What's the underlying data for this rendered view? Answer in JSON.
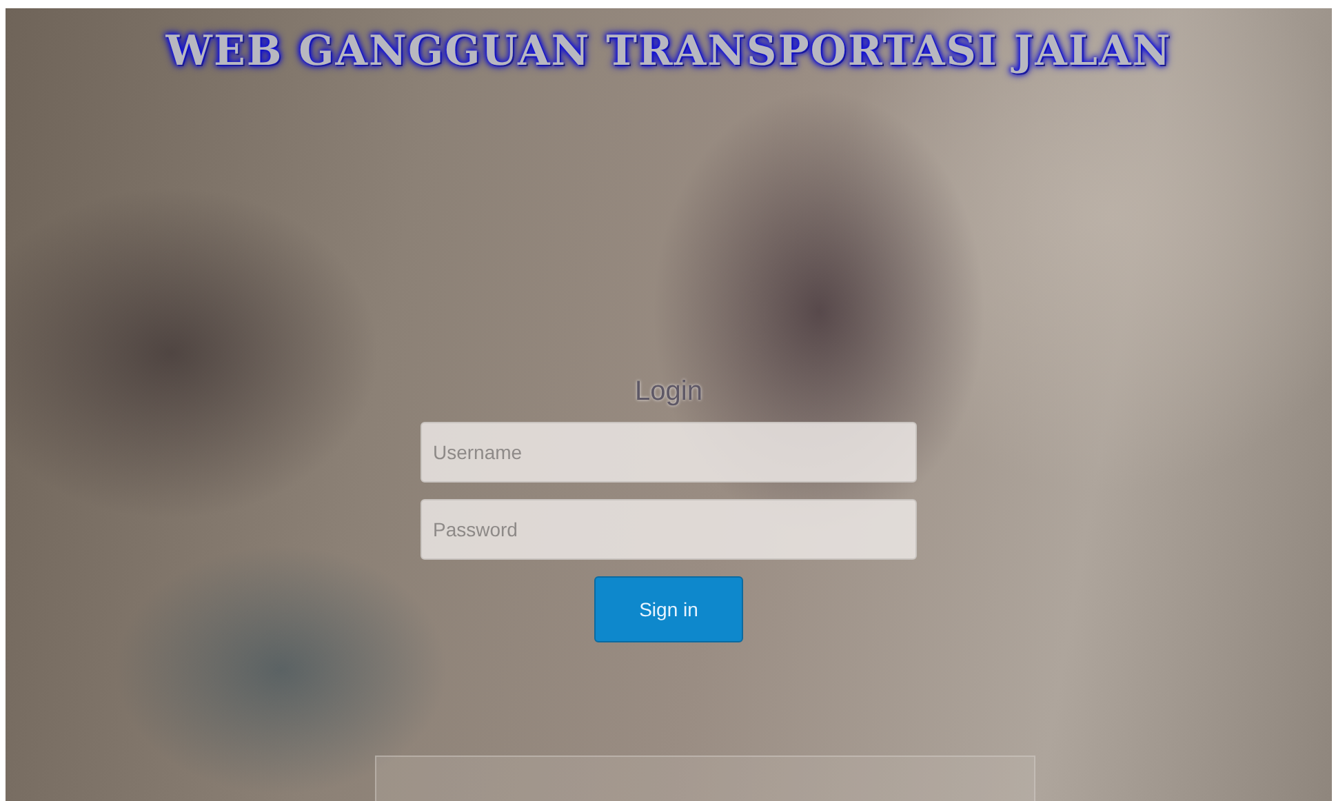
{
  "header": {
    "title": "WEB GANGGUAN TRANSPORTASI JALAN"
  },
  "login": {
    "heading": "Login",
    "fields": [
      {
        "placeholder": "Username"
      },
      {
        "placeholder": "Password"
      }
    ],
    "button": "Sign in"
  }
}
